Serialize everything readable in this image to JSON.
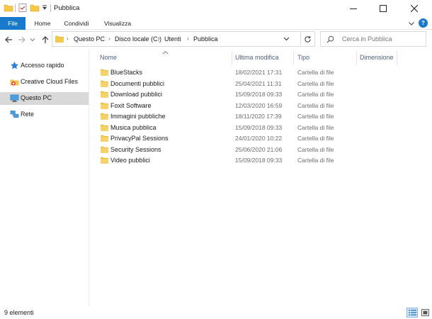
{
  "window": {
    "title": "Pubblica",
    "controls": [
      "minimize",
      "maximize",
      "close"
    ]
  },
  "ribbon": {
    "tabs": [
      {
        "label": "File",
        "active": true
      },
      {
        "label": "Home"
      },
      {
        "label": "Condividi"
      },
      {
        "label": "Visualizza"
      }
    ],
    "help_label": "?"
  },
  "address": {
    "crumbs": [
      "Questo PC",
      "Disco locale (C:)",
      "Utenti",
      "Pubblica"
    ],
    "separator": "›"
  },
  "search": {
    "placeholder": "Cerca in Pubblica"
  },
  "sidebar": {
    "items": [
      {
        "label": "Accesso rapido",
        "icon": "star-icon"
      },
      {
        "label": "Creative Cloud Files",
        "icon": "creative-cloud-icon"
      },
      {
        "label": "Questo PC",
        "icon": "computer-icon",
        "selected": true
      },
      {
        "label": "Rete",
        "icon": "network-icon"
      }
    ]
  },
  "columns": {
    "name": "Nome",
    "modified": "Ultima modifica",
    "type": "Tipo",
    "size": "Dimensione"
  },
  "files": [
    {
      "name": "BlueStacks",
      "modified": "18/02/2021 17:31",
      "type": "Cartella di file"
    },
    {
      "name": "Documenti pubblici",
      "modified": "25/04/2021 11:31",
      "type": "Cartella di file"
    },
    {
      "name": "Download pubblici",
      "modified": "15/09/2018 09:33",
      "type": "Cartella di file"
    },
    {
      "name": "Foxit Software",
      "modified": "12/03/2020 16:59",
      "type": "Cartella di file"
    },
    {
      "name": "Immagini pubbliche",
      "modified": "18/11/2020 17:39",
      "type": "Cartella di file"
    },
    {
      "name": "Musica pubblica",
      "modified": "15/09/2018 09:33",
      "type": "Cartella di file"
    },
    {
      "name": "PrivacyPal Sessions",
      "modified": "24/01/2020 10:22",
      "type": "Cartella di file"
    },
    {
      "name": "Security Sessions",
      "modified": "25/06/2020 21:06",
      "type": "Cartella di file"
    },
    {
      "name": "Video pubblici",
      "modified": "15/09/2018 09:33",
      "type": "Cartella di file"
    }
  ],
  "status": {
    "count": "9 elementi"
  },
  "colors": {
    "accent": "#1979ca",
    "folder": "#f4c948",
    "selection": "#d9d9d9"
  }
}
